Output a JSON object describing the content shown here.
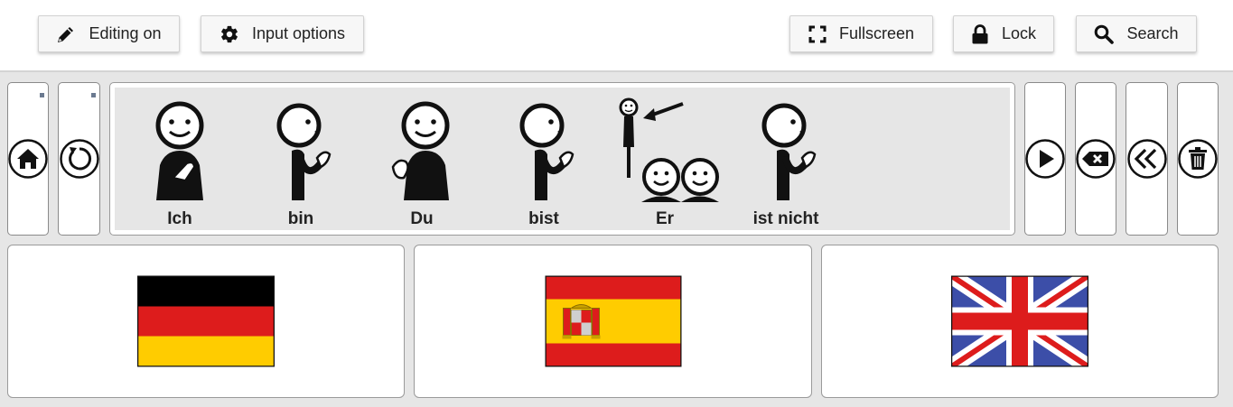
{
  "toolbar": {
    "editing": {
      "label": "Editing on",
      "icon": "pencil-icon"
    },
    "input_options": {
      "label": "Input options",
      "icon": "gear-icon"
    },
    "fullscreen": {
      "label": "Fullscreen",
      "icon": "fullscreen-icon"
    },
    "lock": {
      "label": "Lock",
      "icon": "lock-icon"
    },
    "search": {
      "label": "Search",
      "icon": "search-icon"
    }
  },
  "nav": {
    "home": {
      "icon": "home-icon"
    },
    "back": {
      "icon": "undo-icon"
    }
  },
  "sentence": {
    "words": [
      {
        "label": "Ich",
        "icon": "pictogram-ich"
      },
      {
        "label": "bin",
        "icon": "pictogram-bin"
      },
      {
        "label": "Du",
        "icon": "pictogram-du"
      },
      {
        "label": "bist",
        "icon": "pictogram-bist"
      },
      {
        "label": "Er",
        "icon": "pictogram-er"
      },
      {
        "label": "ist nicht",
        "icon": "pictogram-ist-nicht"
      }
    ]
  },
  "actions": {
    "speak": {
      "icon": "play-icon"
    },
    "backspace": {
      "icon": "backspace-icon"
    },
    "clear_word": {
      "icon": "double-chevron-left-icon"
    },
    "delete_all": {
      "icon": "trash-icon"
    }
  },
  "languages": [
    {
      "flag": "flag-germany-icon",
      "colors": [
        "#000000",
        "#dd1c1c",
        "#ffcc00"
      ]
    },
    {
      "flag": "flag-spain-icon",
      "colors": [
        "#c60b1e",
        "#ffc400"
      ]
    },
    {
      "flag": "flag-united-kingdom-icon",
      "colors": [
        "#012169",
        "#ffffff",
        "#c8102e"
      ]
    }
  ]
}
